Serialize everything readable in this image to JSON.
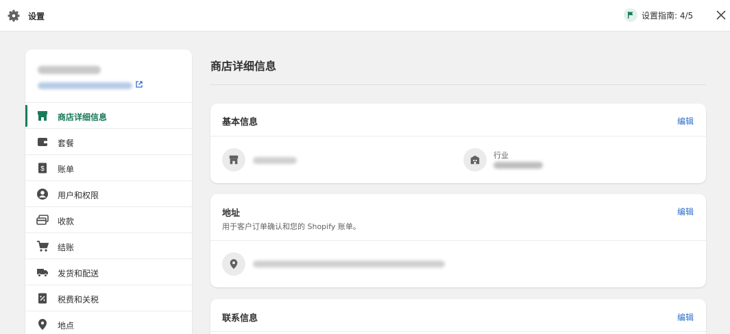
{
  "header": {
    "title": "设置",
    "guide_text": "设置指南: 4/5",
    "icons": [
      "gear-icon",
      "flag-icon",
      "close-icon"
    ]
  },
  "sidebar": {
    "items": [
      {
        "label": "商店详细信息",
        "icon": "store-icon",
        "active": true
      },
      {
        "label": "套餐",
        "icon": "wallet-icon",
        "active": false
      },
      {
        "label": "账单",
        "icon": "bill-icon",
        "active": false
      },
      {
        "label": "用户和权限",
        "icon": "user-circle-icon",
        "active": false
      },
      {
        "label": "收款",
        "icon": "card-icon",
        "active": false
      },
      {
        "label": "结账",
        "icon": "cart-icon",
        "active": false
      },
      {
        "label": "发货和配送",
        "icon": "truck-icon",
        "active": false
      },
      {
        "label": "税费和关税",
        "icon": "tax-icon",
        "active": false
      },
      {
        "label": "地点",
        "icon": "location-pin-icon",
        "active": false
      }
    ]
  },
  "main": {
    "page_title": "商店详细信息",
    "basic_info": {
      "title": "基本信息",
      "edit": "编辑",
      "industry_label": "行业"
    },
    "address": {
      "title": "地址",
      "subtitle": "用于客户订单确认和您的 Shopify 账单。",
      "edit": "编辑"
    },
    "contact": {
      "title": "联系信息",
      "edit": "编辑"
    }
  },
  "colors": {
    "accent_green": "#1a7a5a",
    "link_blue": "#2c6ecb",
    "background": "#f1f1f1"
  }
}
